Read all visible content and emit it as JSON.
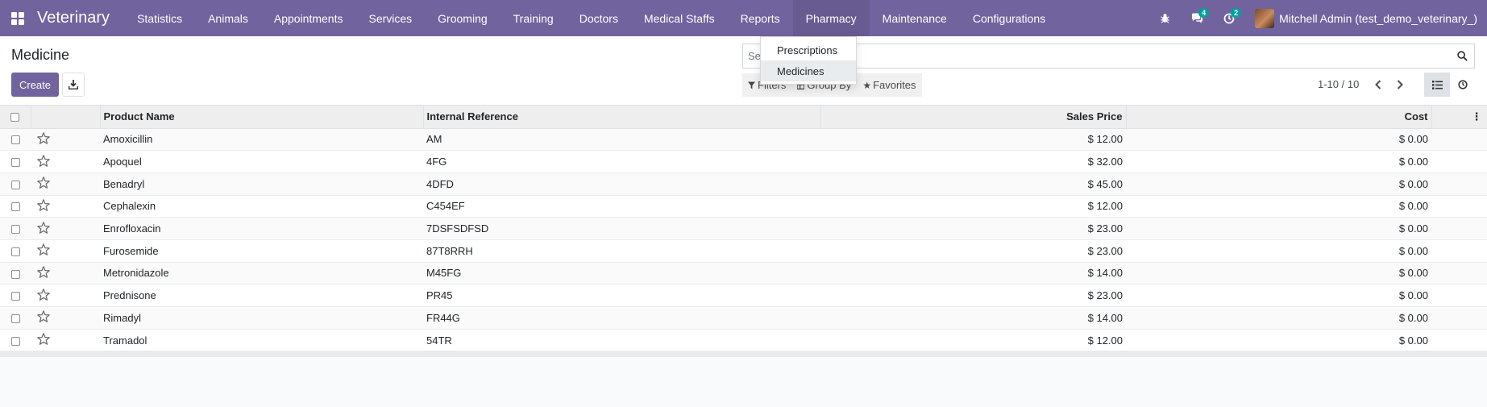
{
  "navbar": {
    "brand": "Veterinary",
    "menu": [
      {
        "label": "Statistics"
      },
      {
        "label": "Animals"
      },
      {
        "label": "Appointments"
      },
      {
        "label": "Services"
      },
      {
        "label": "Grooming"
      },
      {
        "label": "Training"
      },
      {
        "label": "Doctors"
      },
      {
        "label": "Medical Staffs"
      },
      {
        "label": "Reports"
      },
      {
        "label": "Pharmacy"
      },
      {
        "label": "Maintenance"
      },
      {
        "label": "Configurations"
      }
    ],
    "messages_count": "4",
    "activities_count": "2",
    "user_name": "Mitchell Admin (test_demo_veterinary_)",
    "accent_color": "#71639e"
  },
  "pharmacy_dropdown": {
    "items": [
      {
        "label": "Prescriptions"
      },
      {
        "label": "Medicines"
      }
    ]
  },
  "control_panel": {
    "title": "Medicine",
    "create_label": "Create",
    "search_placeholder": "Search...",
    "filters_label": "Filters",
    "group_by_label": "Group By",
    "favorites_label": "Favorites",
    "pager": "1-10 / 10"
  },
  "table": {
    "columns": {
      "product_name": "Product Name",
      "internal_reference": "Internal Reference",
      "sales_price": "Sales Price",
      "cost": "Cost"
    },
    "rows": [
      {
        "name": "Amoxicillin",
        "ref": "AM",
        "price": "$ 12.00",
        "cost": "$ 0.00"
      },
      {
        "name": "Apoquel",
        "ref": "4FG",
        "price": "$ 32.00",
        "cost": "$ 0.00"
      },
      {
        "name": "Benadryl",
        "ref": "4DFD",
        "price": "$ 45.00",
        "cost": "$ 0.00"
      },
      {
        "name": "Cephalexin",
        "ref": "C454EF",
        "price": "$ 12.00",
        "cost": "$ 0.00"
      },
      {
        "name": "Enrofloxacin",
        "ref": "7DSFSDFSD",
        "price": "$ 23.00",
        "cost": "$ 0.00"
      },
      {
        "name": "Furosemide",
        "ref": "87T8RRH",
        "price": "$ 23.00",
        "cost": "$ 0.00"
      },
      {
        "name": "Metronidazole",
        "ref": "M45FG",
        "price": "$ 14.00",
        "cost": "$ 0.00"
      },
      {
        "name": "Prednisone",
        "ref": "PR45",
        "price": "$ 23.00",
        "cost": "$ 0.00"
      },
      {
        "name": "Rimadyl",
        "ref": "FR44G",
        "price": "$ 14.00",
        "cost": "$ 0.00"
      },
      {
        "name": "Tramadol",
        "ref": "54TR",
        "price": "$ 12.00",
        "cost": "$ 0.00"
      }
    ]
  }
}
